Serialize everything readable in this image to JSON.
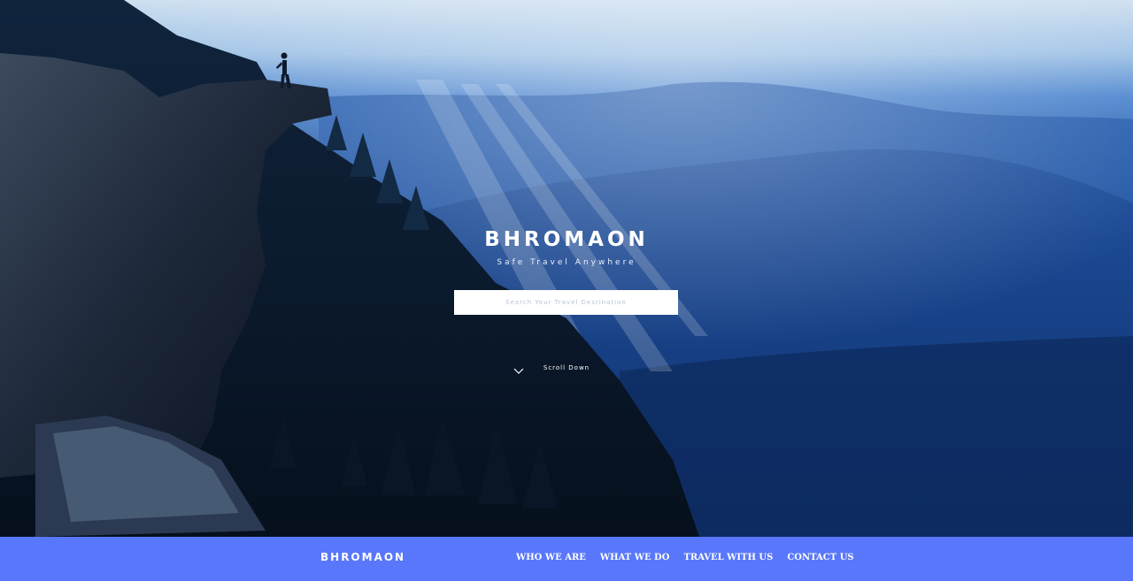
{
  "hero": {
    "title": "BHROMAON",
    "tagline": "Safe Travel Anywhere",
    "search_placeholder": "Search Your Travel Destination",
    "scroll_label": "Scroll Down"
  },
  "navbar": {
    "brand": "BHROMAON",
    "links": [
      {
        "label": "WHO WE ARE"
      },
      {
        "label": "WHAT WE DO"
      },
      {
        "label": "TRAVEL WITH US"
      },
      {
        "label": "CONTACT US"
      }
    ]
  },
  "colors": {
    "navbar_bg": "#5877fa",
    "text": "#ffffff"
  }
}
